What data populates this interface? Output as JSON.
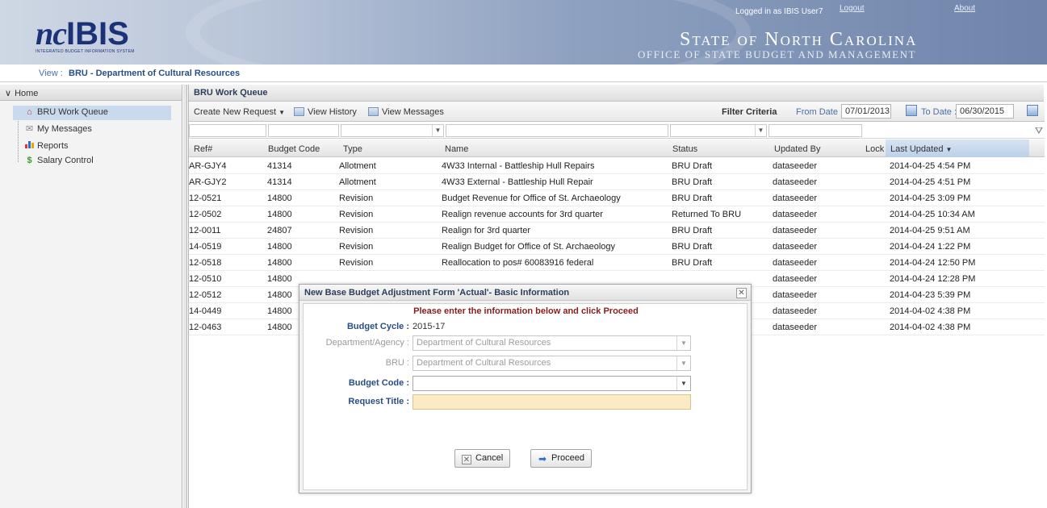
{
  "header": {
    "logo_nc": "nc",
    "logo_ibis": "IBIS",
    "logo_tagline": "INTEGRATED BUDGET INFORMATION SYSTEM",
    "logged_in": "Logged in as IBIS User7",
    "logout": "Logout",
    "about": "About",
    "state": "State of North Carolina",
    "office": "Office of State Budget and Management"
  },
  "view": {
    "label": "View :",
    "value": "BRU - Department of Cultural Resources"
  },
  "sidebar": {
    "home": "Home",
    "items": [
      {
        "label": "BRU Work Queue",
        "icon": "house-icon",
        "selected": true
      },
      {
        "label": "My Messages",
        "icon": "envelope-icon",
        "selected": false
      },
      {
        "label": "Reports",
        "icon": "bar-chart-icon",
        "selected": false
      },
      {
        "label": "Salary Control",
        "icon": "dollar-icon",
        "selected": false
      }
    ]
  },
  "workqueue": {
    "title": "BRU Work Queue",
    "toolbar": {
      "create": "Create New Request",
      "view_history": "View History",
      "view_messages": "View Messages",
      "filter_criteria": "Filter Criteria",
      "from_label": "From Date :",
      "from_value": "07/01/2013",
      "to_label": "To Date :",
      "to_value": "06/30/2015"
    },
    "columns": [
      "Ref#",
      "Budget Code",
      "Type",
      "Name",
      "Status",
      "Updated By",
      "Lock",
      "Last Updated"
    ],
    "sort_indicator": "▼",
    "rows": [
      [
        "AR-GJY4",
        "41314",
        "Allotment",
        "4W33 Internal - Battleship Hull Repairs",
        "BRU Draft",
        "dataseeder",
        "",
        "2014-04-25 4:54 PM"
      ],
      [
        "AR-GJY2",
        "41314",
        "Allotment",
        "4W33 External - Battleship Hull Repair",
        "BRU Draft",
        "dataseeder",
        "",
        "2014-04-25 4:51 PM"
      ],
      [
        "12-0521",
        "14800",
        "Revision",
        "Budget Revenue for Office of St. Archaeology",
        "BRU Draft",
        "dataseeder",
        "",
        "2014-04-25 3:09 PM"
      ],
      [
        "12-0502",
        "14800",
        "Revision",
        "Realign revenue accounts for 3rd quarter",
        "Returned To BRU",
        "dataseeder",
        "",
        "2014-04-25 10:34 AM"
      ],
      [
        "12-0011",
        "24807",
        "Revision",
        "Realign for 3rd quarter",
        "BRU Draft",
        "dataseeder",
        "",
        "2014-04-25 9:51 AM"
      ],
      [
        "14-0519",
        "14800",
        "Revision",
        "Realign Budget for Office of St. Archaeology",
        "BRU Draft",
        "dataseeder",
        "",
        "2014-04-24 1:22 PM"
      ],
      [
        "12-0518",
        "14800",
        "Revision",
        "Reallocation to pos# 60083916 federal",
        "BRU Draft",
        "dataseeder",
        "",
        "2014-04-24 12:50 PM"
      ],
      [
        "12-0510",
        "14800",
        "",
        "",
        "",
        "dataseeder",
        "",
        "2014-04-24 12:28 PM"
      ],
      [
        "12-0512",
        "14800",
        "",
        "",
        "",
        "dataseeder",
        "",
        "2014-04-23 5:39 PM"
      ],
      [
        "14-0449",
        "14800",
        "",
        "",
        "",
        "dataseeder",
        "",
        "2014-04-02 4:38 PM"
      ],
      [
        "12-0463",
        "14800",
        "",
        "",
        "",
        "dataseeder",
        "",
        "2014-04-02 4:38 PM"
      ]
    ]
  },
  "modal": {
    "title": "New Base Budget Adjustment Form 'Actual'- Basic Information",
    "close": "✕",
    "instruction": "Please enter the information below and click Proceed",
    "budget_cycle_label": "Budget Cycle :",
    "budget_cycle_value": "2015-17",
    "dept_label": "Department/Agency :",
    "dept_value": "Department of Cultural Resources",
    "bru_label": "BRU :",
    "bru_value": "Department of Cultural Resources",
    "budget_code_label": "Budget Code :",
    "budget_code_value": "",
    "request_title_label": "Request Title :",
    "request_title_value": "",
    "cancel": "Cancel",
    "proceed": "Proceed"
  }
}
